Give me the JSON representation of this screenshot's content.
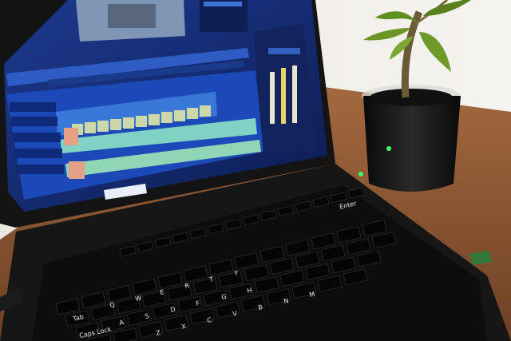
{
  "scene": {
    "description_colors": {
      "wall": "#f2f0ec",
      "desk": "#8a5a36",
      "laptop": "#141414",
      "screen_ui": "#1c3f9e",
      "timeline": "#3a78d8",
      "plant_leaf": "#6f9a2a",
      "led": "#3cff6a"
    }
  },
  "keyboard": {
    "keys": {
      "tab": "Tab",
      "caps_lock": "Caps Lock",
      "enter": "Enter",
      "q": "Q",
      "w": "W",
      "e": "E",
      "r": "R",
      "t": "T",
      "y": "Y",
      "a": "A",
      "s": "S",
      "d": "D",
      "f": "F",
      "g": "G",
      "h": "H",
      "z": "Z",
      "x": "X",
      "c": "C",
      "v": "V",
      "b": "B",
      "n": "N",
      "m": "M"
    }
  }
}
